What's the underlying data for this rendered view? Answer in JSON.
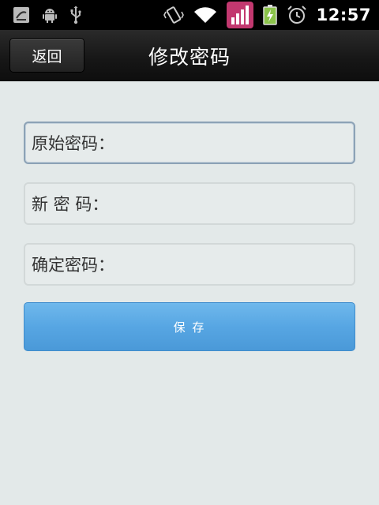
{
  "status_bar": {
    "time": "12:57",
    "icons": [
      "no-sim-icon",
      "android-icon",
      "usb-icon",
      "vibrate-icon",
      "wifi-icon",
      "signal-icon",
      "battery-charging-icon",
      "alarm-icon"
    ],
    "colors": {
      "signal_bg": "#c2386f",
      "battery": "#8bc34a"
    }
  },
  "header": {
    "back_label": "返回",
    "title": "修改密码"
  },
  "form": {
    "old_password_label": "原始密码：",
    "new_password_label": "新 密 码：",
    "confirm_password_label": "确定密码：",
    "old_password_value": "",
    "new_password_value": "",
    "confirm_password_value": ""
  },
  "actions": {
    "save_label": "保 存"
  },
  "colors": {
    "background": "#e3e9e9",
    "save_button": "#57a6e3"
  }
}
